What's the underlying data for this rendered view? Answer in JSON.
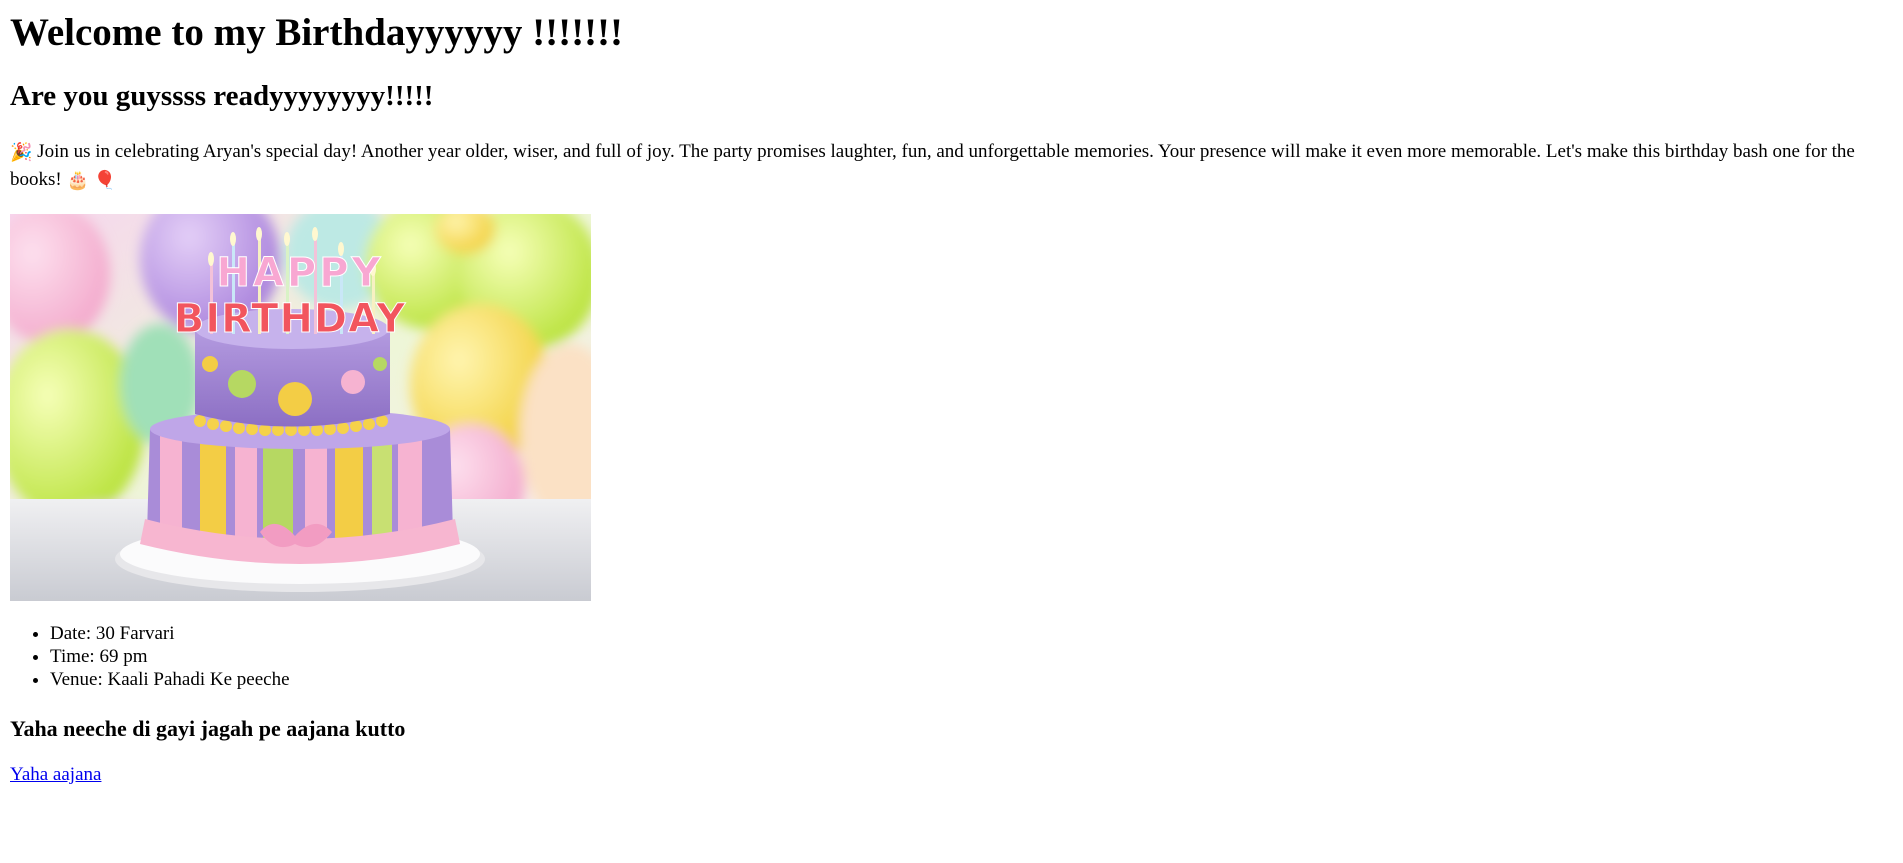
{
  "page": {
    "heading": "Welcome to my Birthdayyyyyy !!!!!!!",
    "subheading": "Are you guyssss readyyyyyyyy!!!!!",
    "intro": {
      "party_emoji": "🎉",
      "text": " Join us in celebrating Aryan's special day! Another year older, wiser, and full of joy. The party promises laughter, fun, and unforgettable memories. Your presence will make it even more memorable. Let's make this birthday bash one for the books! ",
      "cake_emoji": "🎂",
      "balloon_emoji": "🎈"
    },
    "image": {
      "alt": "Happy Birthday cake with candles",
      "candle_text_top": "HAPPY",
      "candle_text_bottom": "BIRTHDAY"
    },
    "details": [
      {
        "text": "Date: 30 Farvari"
      },
      {
        "text": "Time: 69 pm"
      },
      {
        "text": "Venue: Kaali Pahadi Ke peeche"
      }
    ],
    "directions_heading": "Yaha neeche di gayi jagah pe aajana kutto",
    "link_label": "Yaha aajana"
  },
  "colors": {
    "link": "#0000ee",
    "text": "#000000",
    "background": "#ffffff"
  }
}
